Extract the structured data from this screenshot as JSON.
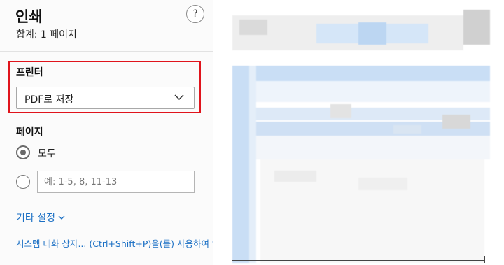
{
  "dialog": {
    "title": "인쇄",
    "subtitle": "합계: 1 페이지",
    "help_label": "?"
  },
  "printer": {
    "label": "프린터",
    "selected": "PDF로 저장",
    "icon": "chevron-down-icon"
  },
  "pages": {
    "label": "페이지",
    "options": [
      {
        "label": "모두",
        "selected": true
      },
      {
        "label": "",
        "selected": false
      }
    ],
    "range_placeholder": "예: 1-5, 8, 11-13",
    "range_value": ""
  },
  "more_settings": {
    "label": "기타 설정",
    "icon": "chevron-down-icon"
  },
  "system_dialog_link": "시스템 대화 상자... (Ctrl+Shift+P)을(를) 사용하여 인",
  "colors": {
    "link": "#1a6fc4",
    "highlight_border": "#e0141c",
    "panel_bg": "#fbfbfb",
    "preview_accent": "#bcd6f2"
  }
}
